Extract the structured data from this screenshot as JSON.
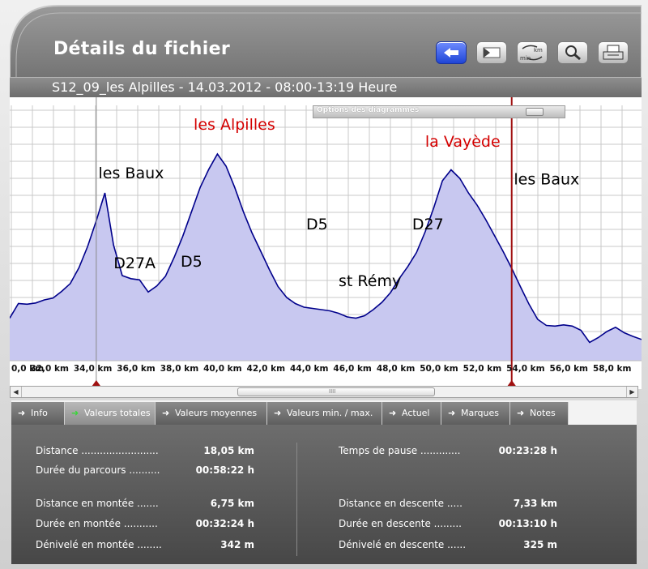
{
  "header": {
    "title": "Détails du fichier",
    "subtitle": "S12_09_les Alpilles - 14.03.2012 - 08:00-13:19 Heure",
    "toolbar": [
      {
        "name": "back-button",
        "icon": "back-arrow-icon"
      },
      {
        "name": "view-toggle-button",
        "icon": "panel-toggle-icon"
      },
      {
        "name": "units-button",
        "icon": "km-min-switch-icon",
        "text_top": "km",
        "text_bottom": "min"
      },
      {
        "name": "zoom-button",
        "icon": "magnifier-icon"
      },
      {
        "name": "print-button",
        "icon": "printer-icon"
      }
    ]
  },
  "chart": {
    "options_label": "Options des diagrammes"
  },
  "chart_data": {
    "type": "area",
    "xlabel": "",
    "ylabel": "",
    "x_ticks": [
      "0,0 km",
      "32,0 km",
      "34,0 km",
      "36,0 km",
      "38,0 km",
      "40,0 km",
      "42,0 km",
      "44,0 km",
      "46,0 km",
      "48,0 km",
      "50,0 km",
      "52,0 km",
      "54,0 km",
      "56,0 km",
      "58,0 km"
    ],
    "x": [
      30.0,
      30.4,
      30.8,
      31.2,
      31.6,
      32.0,
      32.4,
      32.8,
      33.2,
      33.6,
      34.0,
      34.4,
      34.8,
      35.2,
      35.6,
      36.0,
      36.4,
      36.8,
      37.2,
      37.6,
      38.0,
      38.4,
      38.8,
      39.2,
      39.6,
      40.0,
      40.4,
      40.8,
      41.2,
      41.6,
      42.0,
      42.4,
      42.8,
      43.2,
      43.6,
      44.0,
      44.4,
      44.8,
      45.2,
      45.6,
      46.0,
      46.4,
      46.8,
      47.2,
      47.6,
      48.0,
      48.4,
      48.8,
      49.2,
      49.6,
      50.0,
      50.4,
      50.8,
      51.2,
      51.6,
      52.0,
      52.4,
      52.8,
      53.2,
      53.6,
      54.0,
      54.4,
      54.8,
      55.2,
      55.6,
      56.0,
      56.4,
      56.8,
      57.2,
      57.6,
      58.0,
      58.4,
      58.8,
      59.2
    ],
    "values": [
      70,
      94,
      93,
      95,
      100,
      103,
      114,
      127,
      153,
      188,
      230,
      276,
      190,
      140,
      135,
      133,
      113,
      123,
      139,
      170,
      205,
      245,
      285,
      315,
      340,
      320,
      285,
      245,
      210,
      180,
      150,
      122,
      104,
      94,
      88,
      86,
      84,
      82,
      78,
      72,
      70,
      74,
      84,
      96,
      112,
      135,
      155,
      178,
      212,
      252,
      296,
      314,
      300,
      276,
      256,
      232,
      206,
      180,
      152,
      122,
      93,
      68,
      58,
      57,
      59,
      57,
      50,
      30,
      38,
      48,
      55,
      46,
      40,
      35
    ],
    "ylim": [
      0,
      380
    ],
    "annotations": [
      {
        "text": "les Baux",
        "x": 34.1,
        "y": 300,
        "color": "#000000"
      },
      {
        "text": "les Alpilles",
        "x": 38.5,
        "y": 380,
        "color": "#d40000"
      },
      {
        "text": "la Vayède",
        "x": 49.2,
        "y": 352,
        "color": "#d40000"
      },
      {
        "text": "les Baux",
        "x": 53.3,
        "y": 290,
        "color": "#000000"
      },
      {
        "text": "D27A",
        "x": 34.8,
        "y": 152,
        "color": "#000000"
      },
      {
        "text": "D5",
        "x": 37.9,
        "y": 155,
        "color": "#000000"
      },
      {
        "text": "D5",
        "x": 43.7,
        "y": 216,
        "color": "#000000"
      },
      {
        "text": "D27",
        "x": 48.6,
        "y": 216,
        "color": "#000000"
      },
      {
        "text": "st Rémy",
        "x": 45.2,
        "y": 123,
        "color": "#000000"
      }
    ],
    "markers": [
      {
        "name": "start-marker",
        "x": 34.0,
        "color": "#8a8a8a"
      },
      {
        "name": "position-marker",
        "x": 53.2,
        "color": "#a01010"
      }
    ],
    "grid": true,
    "fill_color": "#c8c8f0",
    "line_color": "#00008b"
  },
  "tabs": [
    {
      "label": "Info",
      "active": false
    },
    {
      "label": "Valeurs totales",
      "active": true
    },
    {
      "label": "Valeurs moyennes",
      "active": false
    },
    {
      "label": "Valeurs min. / max.",
      "active": false
    },
    {
      "label": "Actuel",
      "active": false
    },
    {
      "label": "Marques",
      "active": false
    },
    {
      "label": "Notes",
      "active": false
    }
  ],
  "stats": {
    "distance_label": "Distance .........................",
    "distance_value": "18,05 km",
    "duree_label": "Durée du parcours ..........",
    "duree_value": "00:58:22 h",
    "pause_label": "Temps de pause .............",
    "pause_value": "00:23:28 h",
    "dist_montee_label": "Distance en montée  .......",
    "dist_montee_value": "6,75 km",
    "duree_montee_label": "Durée en montée  ...........",
    "duree_montee_value": "00:32:24 h",
    "deniv_montee_label": "Dénivelé en montée ........",
    "deniv_montee_value": "342 m",
    "dist_descente_label": "Distance en descente  .....",
    "dist_descente_value": "7,33 km",
    "duree_descente_label": "Durée en descente  .........",
    "duree_descente_value": "00:13:10 h",
    "deniv_descente_label": "Dénivelé en descente ......",
    "deniv_descente_value": "325 m"
  },
  "scrollbar": {
    "grip": "IIII",
    "left_arrow": "◀",
    "right_arrow": "▶"
  }
}
